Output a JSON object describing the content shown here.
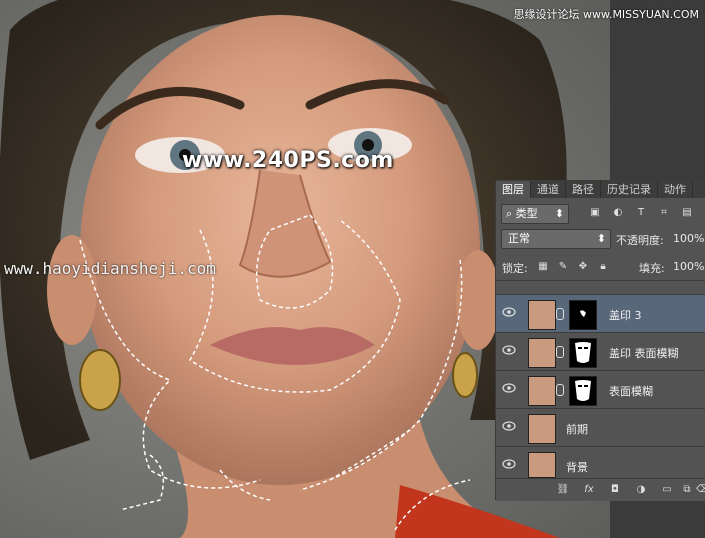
{
  "watermarks": {
    "main": "www.240PS.com",
    "url": "www.haoyidiansheji.com",
    "top": "思缘设计论坛 www.MISSYUAN.COM"
  },
  "layers_panel": {
    "tabs": [
      "图层",
      "通道",
      "路径",
      "历史记录",
      "动作"
    ],
    "filter": {
      "icon": "search-icon",
      "label": "类型"
    },
    "blend_mode": "正常",
    "opacity_label": "不透明度:",
    "opacity_value": "100%",
    "lock_label": "锁定:",
    "fill_label": "填充:",
    "fill_value": "100%",
    "layers": [
      {
        "name": "盖印 3",
        "visible": true,
        "selected": true,
        "has_mask": true
      },
      {
        "name": "盖印 表面模糊",
        "visible": true,
        "selected": false,
        "has_mask": true
      },
      {
        "name": "表面模糊",
        "visible": true,
        "selected": false,
        "has_mask": true
      },
      {
        "name": "前期",
        "visible": true,
        "selected": false,
        "has_mask": false
      },
      {
        "name": "背景",
        "visible": true,
        "selected": false,
        "has_mask": false
      }
    ],
    "footer_icons": [
      "link-icon",
      "fx-icon",
      "mask-icon",
      "adjustment-icon",
      "folder-icon",
      "new-layer-icon",
      "trash-icon"
    ]
  },
  "colors": {
    "panel_bg": "#535353",
    "selected_row": "#59677a"
  }
}
